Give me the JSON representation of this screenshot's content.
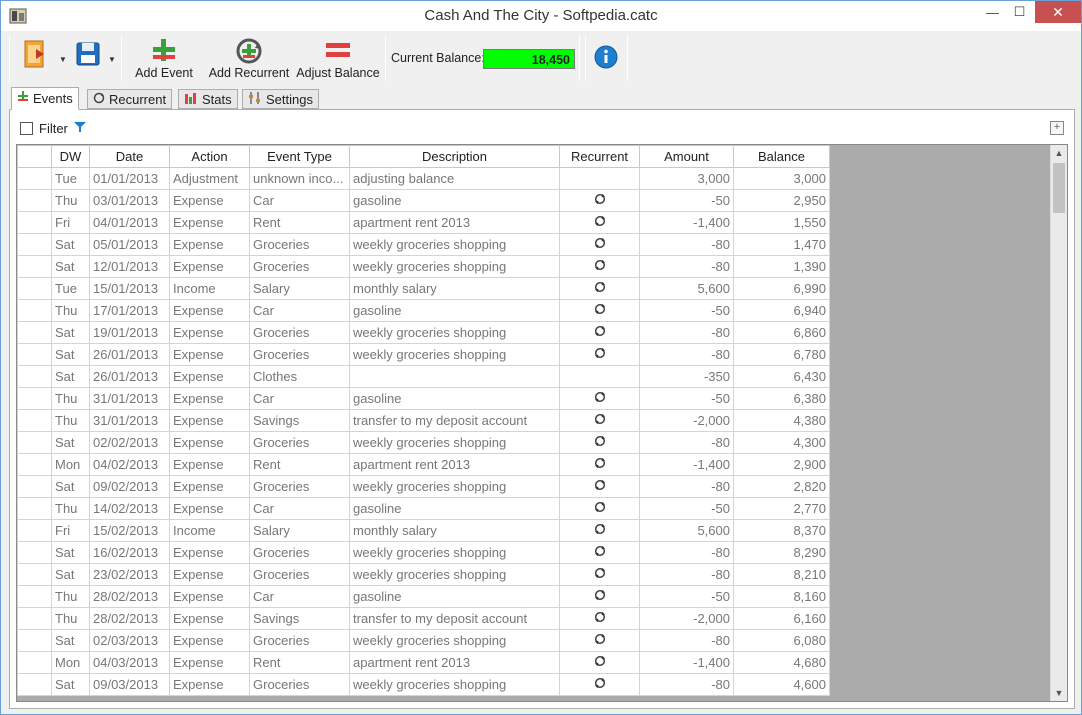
{
  "window": {
    "title": "Cash And The City - Softpedia.catc",
    "min_glyph": "—",
    "max_glyph": "☐",
    "close_glyph": "✕"
  },
  "toolbar": {
    "add_event": "Add Event",
    "add_recurrent": "Add Recurrent",
    "adjust_balance": "Adjust Balance",
    "balance_label": "Current Balance:",
    "balance_value": "18,450",
    "balance_color": "#00ff00"
  },
  "tabs": [
    {
      "label": "Events",
      "icon": "events-icon",
      "active": true
    },
    {
      "label": "Recurrent",
      "icon": "recurrent-icon",
      "active": false
    },
    {
      "label": "Stats",
      "icon": "stats-icon",
      "active": false
    },
    {
      "label": "Settings",
      "icon": "settings-icon",
      "active": false
    }
  ],
  "filter": {
    "label": "Filter"
  },
  "grid": {
    "columns": [
      "DW",
      "Date",
      "Action",
      "Event Type",
      "Description",
      "Recurrent",
      "Amount",
      "Balance"
    ],
    "rows": [
      {
        "dw": "Tue",
        "date": "01/01/2013",
        "action": "Adjustment",
        "type": "unknown inco...",
        "desc": "adjusting balance",
        "recurrent": false,
        "amount": "3,000",
        "balance": "3,000"
      },
      {
        "dw": "Thu",
        "date": "03/01/2013",
        "action": "Expense",
        "type": "Car",
        "desc": "gasoline",
        "recurrent": true,
        "amount": "-50",
        "balance": "2,950"
      },
      {
        "dw": "Fri",
        "date": "04/01/2013",
        "action": "Expense",
        "type": "Rent",
        "desc": "apartment rent 2013",
        "recurrent": true,
        "amount": "-1,400",
        "balance": "1,550"
      },
      {
        "dw": "Sat",
        "date": "05/01/2013",
        "action": "Expense",
        "type": "Groceries",
        "desc": "weekly groceries shopping",
        "recurrent": true,
        "amount": "-80",
        "balance": "1,470"
      },
      {
        "dw": "Sat",
        "date": "12/01/2013",
        "action": "Expense",
        "type": "Groceries",
        "desc": "weekly groceries shopping",
        "recurrent": true,
        "amount": "-80",
        "balance": "1,390"
      },
      {
        "dw": "Tue",
        "date": "15/01/2013",
        "action": "Income",
        "type": "Salary",
        "desc": "monthly salary",
        "recurrent": true,
        "amount": "5,600",
        "balance": "6,990"
      },
      {
        "dw": "Thu",
        "date": "17/01/2013",
        "action": "Expense",
        "type": "Car",
        "desc": "gasoline",
        "recurrent": true,
        "amount": "-50",
        "balance": "6,940"
      },
      {
        "dw": "Sat",
        "date": "19/01/2013",
        "action": "Expense",
        "type": "Groceries",
        "desc": "weekly groceries shopping",
        "recurrent": true,
        "amount": "-80",
        "balance": "6,860"
      },
      {
        "dw": "Sat",
        "date": "26/01/2013",
        "action": "Expense",
        "type": "Groceries",
        "desc": "weekly groceries shopping",
        "recurrent": true,
        "amount": "-80",
        "balance": "6,780"
      },
      {
        "dw": "Sat",
        "date": "26/01/2013",
        "action": "Expense",
        "type": "Clothes",
        "desc": "",
        "recurrent": false,
        "amount": "-350",
        "balance": "6,430"
      },
      {
        "dw": "Thu",
        "date": "31/01/2013",
        "action": "Expense",
        "type": "Car",
        "desc": "gasoline",
        "recurrent": true,
        "amount": "-50",
        "balance": "6,380"
      },
      {
        "dw": "Thu",
        "date": "31/01/2013",
        "action": "Expense",
        "type": "Savings",
        "desc": "transfer to my deposit account",
        "recurrent": true,
        "amount": "-2,000",
        "balance": "4,380"
      },
      {
        "dw": "Sat",
        "date": "02/02/2013",
        "action": "Expense",
        "type": "Groceries",
        "desc": "weekly groceries shopping",
        "recurrent": true,
        "amount": "-80",
        "balance": "4,300"
      },
      {
        "dw": "Mon",
        "date": "04/02/2013",
        "action": "Expense",
        "type": "Rent",
        "desc": "apartment rent 2013",
        "recurrent": true,
        "amount": "-1,400",
        "balance": "2,900"
      },
      {
        "dw": "Sat",
        "date": "09/02/2013",
        "action": "Expense",
        "type": "Groceries",
        "desc": "weekly groceries shopping",
        "recurrent": true,
        "amount": "-80",
        "balance": "2,820"
      },
      {
        "dw": "Thu",
        "date": "14/02/2013",
        "action": "Expense",
        "type": "Car",
        "desc": "gasoline",
        "recurrent": true,
        "amount": "-50",
        "balance": "2,770"
      },
      {
        "dw": "Fri",
        "date": "15/02/2013",
        "action": "Income",
        "type": "Salary",
        "desc": "monthly salary",
        "recurrent": true,
        "amount": "5,600",
        "balance": "8,370"
      },
      {
        "dw": "Sat",
        "date": "16/02/2013",
        "action": "Expense",
        "type": "Groceries",
        "desc": "weekly groceries shopping",
        "recurrent": true,
        "amount": "-80",
        "balance": "8,290"
      },
      {
        "dw": "Sat",
        "date": "23/02/2013",
        "action": "Expense",
        "type": "Groceries",
        "desc": "weekly groceries shopping",
        "recurrent": true,
        "amount": "-80",
        "balance": "8,210"
      },
      {
        "dw": "Thu",
        "date": "28/02/2013",
        "action": "Expense",
        "type": "Car",
        "desc": "gasoline",
        "recurrent": true,
        "amount": "-50",
        "balance": "8,160"
      },
      {
        "dw": "Thu",
        "date": "28/02/2013",
        "action": "Expense",
        "type": "Savings",
        "desc": "transfer to my deposit account",
        "recurrent": true,
        "amount": "-2,000",
        "balance": "6,160"
      },
      {
        "dw": "Sat",
        "date": "02/03/2013",
        "action": "Expense",
        "type": "Groceries",
        "desc": "weekly groceries shopping",
        "recurrent": true,
        "amount": "-80",
        "balance": "6,080"
      },
      {
        "dw": "Mon",
        "date": "04/03/2013",
        "action": "Expense",
        "type": "Rent",
        "desc": "apartment rent 2013",
        "recurrent": true,
        "amount": "-1,400",
        "balance": "4,680"
      },
      {
        "dw": "Sat",
        "date": "09/03/2013",
        "action": "Expense",
        "type": "Groceries",
        "desc": "weekly groceries shopping",
        "recurrent": true,
        "amount": "-80",
        "balance": "4,600"
      }
    ]
  }
}
